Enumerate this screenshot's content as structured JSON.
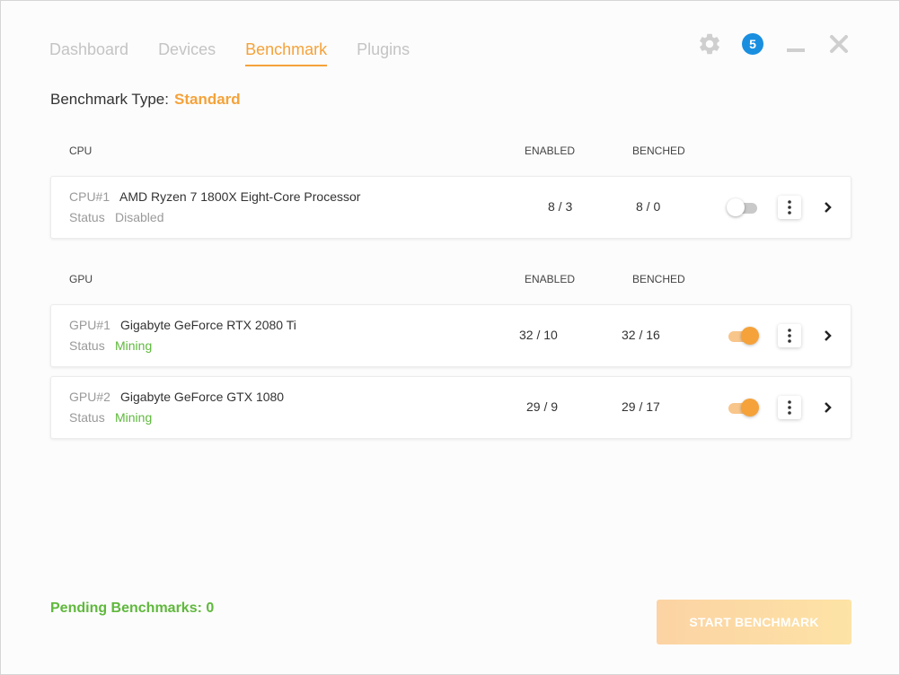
{
  "nav": {
    "tabs": [
      {
        "label": "Dashboard"
      },
      {
        "label": "Devices"
      },
      {
        "label": "Benchmark"
      },
      {
        "label": "Plugins"
      }
    ],
    "active": "Benchmark"
  },
  "header": {
    "notification_count": "5",
    "icons": [
      "gear-icon",
      "minimize-icon",
      "close-icon"
    ]
  },
  "benchmark_type": {
    "label": "Benchmark Type:",
    "value": "Standard"
  },
  "columns": {
    "enabled": "ENABLED",
    "benched": "BENCHED"
  },
  "sections": {
    "cpu": {
      "title": "CPU",
      "devices": [
        {
          "index": "CPU#1",
          "name": "AMD Ryzen 7 1800X Eight-Core Processor",
          "status_label": "Status",
          "status": "Disabled",
          "enabled": "8 / 3",
          "benched": "8 / 0",
          "toggle_on": false
        }
      ]
    },
    "gpu": {
      "title": "GPU",
      "devices": [
        {
          "index": "GPU#1",
          "name": "Gigabyte GeForce RTX 2080 Ti",
          "status_label": "Status",
          "status": "Mining",
          "enabled": "32 / 10",
          "benched": "32 / 16",
          "toggle_on": true
        },
        {
          "index": "GPU#2",
          "name": "Gigabyte GeForce GTX 1080",
          "status_label": "Status",
          "status": "Mining",
          "enabled": "29 / 9",
          "benched": "29 / 17",
          "toggle_on": true
        }
      ]
    }
  },
  "footer": {
    "pending_label": "Pending Benchmarks: 0",
    "start_button": "START BENCHMARK"
  },
  "colors": {
    "accent": "#f5a23a",
    "mining": "#5fb83c",
    "badge": "#1a8fe0"
  }
}
